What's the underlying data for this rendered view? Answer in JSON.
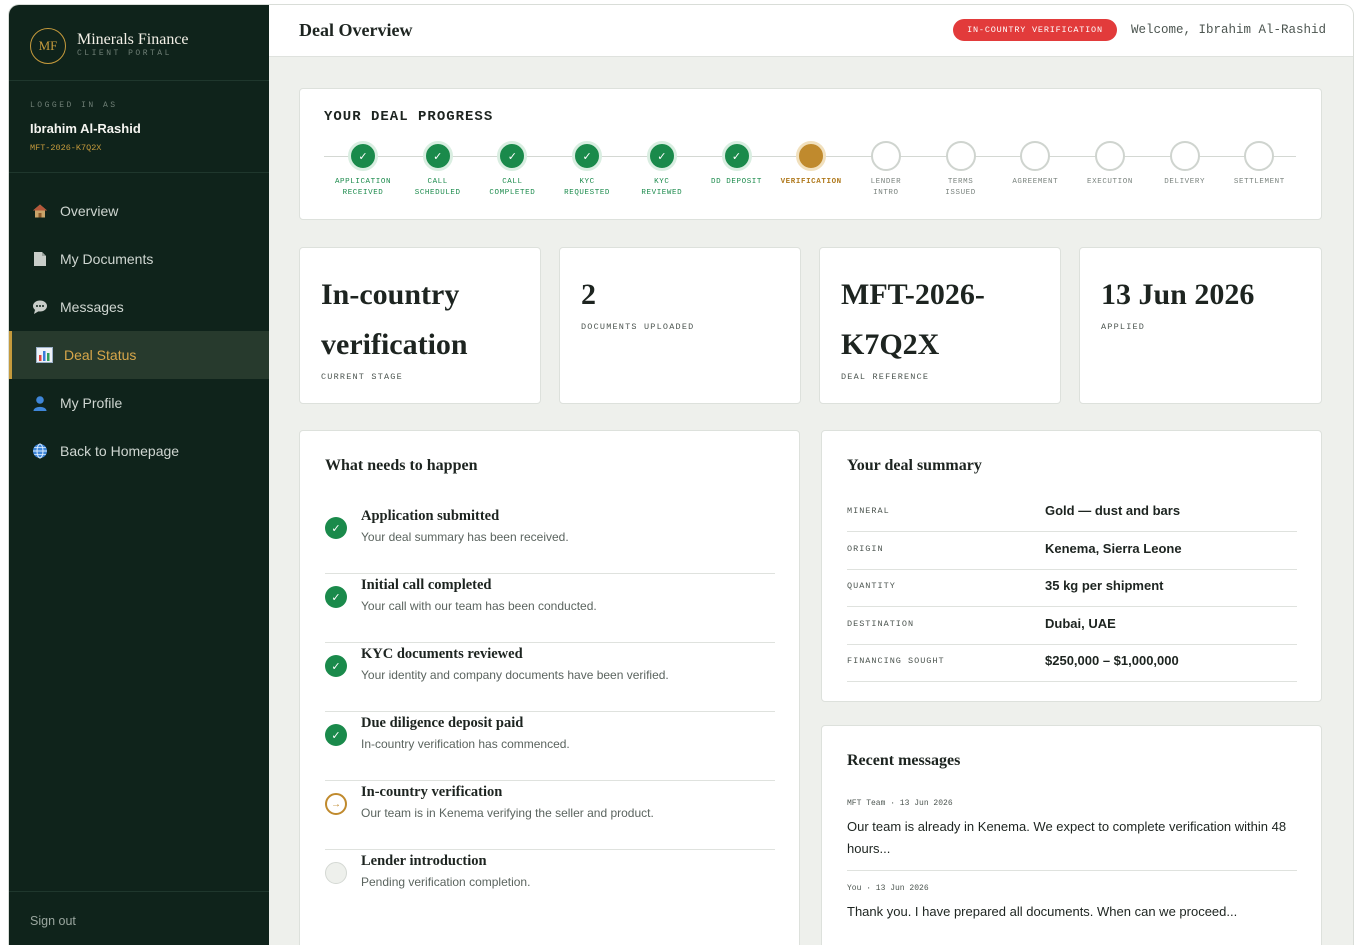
{
  "brand": {
    "initials": "MF",
    "name": "Minerals Finance",
    "sub": "CLIENT PORTAL"
  },
  "user": {
    "label": "LOGGED IN AS",
    "name": "Ibrahim Al-Rashid",
    "ref": "MFT-2026-K7Q2X"
  },
  "nav": [
    {
      "label": "Overview",
      "icon": "house-icon",
      "active": false
    },
    {
      "label": "My Documents",
      "icon": "document-icon",
      "active": false
    },
    {
      "label": "Messages",
      "icon": "chat-bubble-icon",
      "active": false
    },
    {
      "label": "Deal Status",
      "icon": "bar-chart-icon",
      "active": true
    },
    {
      "label": "My Profile",
      "icon": "person-icon",
      "active": false
    },
    {
      "label": "Back to Homepage",
      "icon": "globe-icon",
      "active": false
    }
  ],
  "signout": "Sign out",
  "topbar": {
    "title": "Deal Overview",
    "badge": "IN-COUNTRY VERIFICATION",
    "welcome": "Welcome, Ibrahim Al-Rashid"
  },
  "progress": {
    "title": "YOUR DEAL PROGRESS",
    "check": "✓",
    "steps": [
      {
        "line1": "APPLICATION",
        "line2": "RECEIVED",
        "status": "done"
      },
      {
        "line1": "CALL",
        "line2": "SCHEDULED",
        "status": "done"
      },
      {
        "line1": "CALL",
        "line2": "COMPLETED",
        "status": "done"
      },
      {
        "line1": "KYC",
        "line2": "REQUESTED",
        "status": "done"
      },
      {
        "line1": "KYC",
        "line2": "REVIEWED",
        "status": "done"
      },
      {
        "line1": "DD DEPOSIT",
        "line2": "",
        "status": "done"
      },
      {
        "line1": "VERIFICATION",
        "line2": "",
        "status": "current"
      },
      {
        "line1": "LENDER",
        "line2": "INTRO",
        "status": "pending"
      },
      {
        "line1": "TERMS",
        "line2": "ISSUED",
        "status": "pending"
      },
      {
        "line1": "AGREEMENT",
        "line2": "",
        "status": "pending"
      },
      {
        "line1": "EXECUTION",
        "line2": "",
        "status": "pending"
      },
      {
        "line1": "DELIVERY",
        "line2": "",
        "status": "pending"
      },
      {
        "line1": "SETTLEMENT",
        "line2": "",
        "status": "pending"
      }
    ]
  },
  "stats": [
    {
      "line1": "In-country",
      "line2": "verification",
      "label": "CURRENT STAGE"
    },
    {
      "line1": "2",
      "line2": "",
      "label": "DOCUMENTS UPLOADED"
    },
    {
      "line1": "MFT-2026-",
      "line2": "K7Q2X",
      "label": "DEAL REFERENCE"
    },
    {
      "line1": "13 Jun 2026",
      "line2": "",
      "label": "APPLIED"
    }
  ],
  "happen": {
    "title": "What needs to happen",
    "tasks": [
      {
        "title": "Application submitted",
        "desc": "Your deal summary has been received.",
        "status": "done"
      },
      {
        "title": "Initial call completed",
        "desc": "Your call with our team has been conducted.",
        "status": "done"
      },
      {
        "title": "KYC documents reviewed",
        "desc": "Your identity and company documents have been verified.",
        "status": "done"
      },
      {
        "title": "Due diligence deposit paid",
        "desc": "In-country verification has commenced.",
        "status": "done"
      },
      {
        "title": "In-country verification",
        "desc": "Our team is in Kenema verifying the seller and product.",
        "status": "current"
      },
      {
        "title": "Lender introduction",
        "desc": "Pending verification completion.",
        "status": "pending"
      }
    ],
    "arrow": "→"
  },
  "summary": {
    "title": "Your deal summary",
    "rows": [
      {
        "key": "MINERAL",
        "value": "Gold — dust and bars"
      },
      {
        "key": "ORIGIN",
        "value": "Kenema, Sierra Leone"
      },
      {
        "key": "QUANTITY",
        "value": "35 kg per shipment"
      },
      {
        "key": "DESTINATION",
        "value": "Dubai, UAE"
      },
      {
        "key": "FINANCING SOUGHT",
        "value": "$250,000 – $1,000,000"
      }
    ]
  },
  "messages": {
    "title": "Recent messages",
    "items": [
      {
        "meta": "MFT Team · 13 Jun 2026",
        "text": "Our team is already in Kenema. We expect to complete verification within 48 hours..."
      },
      {
        "meta": "You · 13 Jun 2026",
        "text": "Thank you. I have prepared all documents. When can we proceed..."
      }
    ]
  },
  "colors": {
    "sidebar": "#0f231b",
    "accent": "#c59a3c",
    "done": "#1a8a4b",
    "badge": "#e23b3b"
  }
}
